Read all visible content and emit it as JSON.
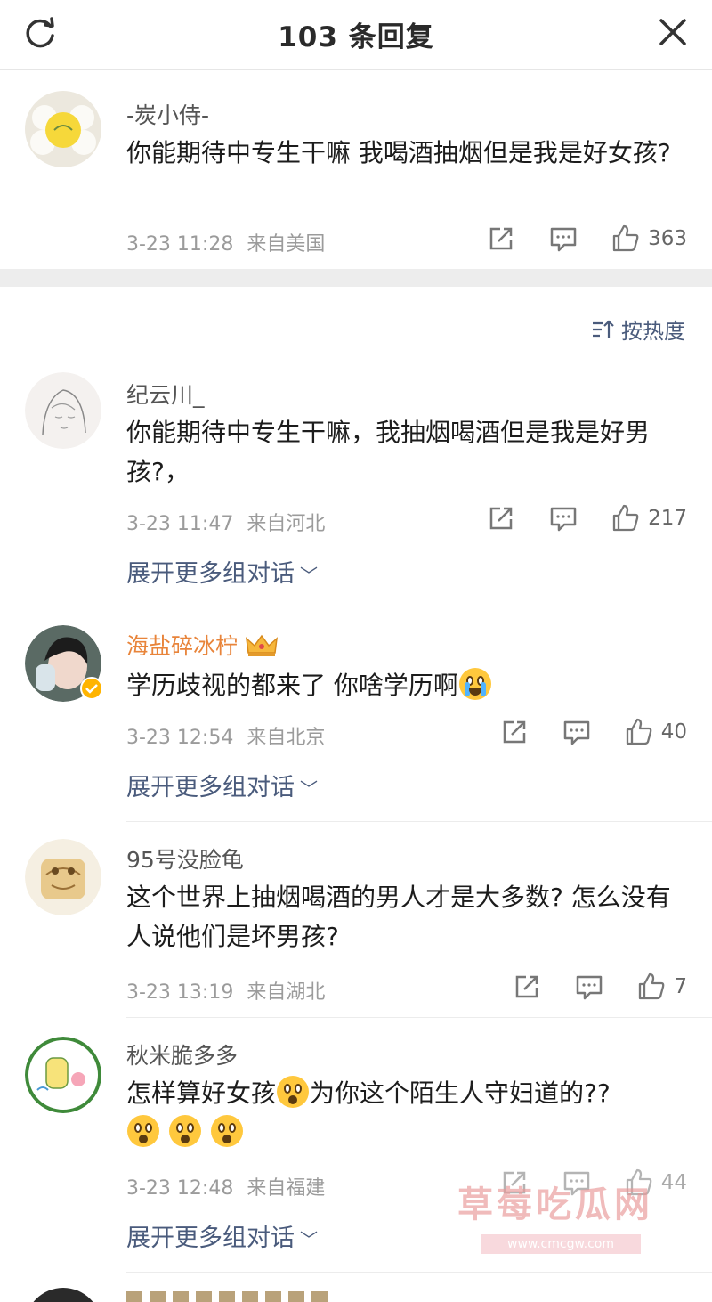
{
  "header": {
    "title": "103 条回复"
  },
  "root_comment": {
    "username": "-炭小侍-",
    "text": "你能期待中专生干嘛 我喝酒抽烟但是我是好女孩?",
    "time": "3-23 11:28",
    "location": "来自美国",
    "likes": "363"
  },
  "sort": {
    "label": "按热度"
  },
  "comments": [
    {
      "username": "纪云川_",
      "text": "你能期待中专生干嘛，我抽烟喝酒但是我是好男孩?，",
      "time": "3-23 11:47",
      "location": "来自河北",
      "likes": "217",
      "expand": "展开更多组对话"
    },
    {
      "username": "海盐碎冰柠",
      "text": "学历歧视的都来了 你啥学历啊",
      "time": "3-23 12:54",
      "location": "来自北京",
      "likes": "40",
      "expand": "展开更多组对话"
    },
    {
      "username": "95号没脸龟",
      "text": "这个世界上抽烟喝酒的男人才是大多数? 怎么没有人说他们是坏男孩?",
      "time": "3-23 13:19",
      "location": "来自湖北",
      "likes": "7"
    },
    {
      "username": "秋米脆多多",
      "text_a": "怎样算好女孩",
      "text_b": "为你这个陌生人守妇道的??",
      "time": "3-23 12:48",
      "location": "来自福建",
      "likes": "44",
      "expand": "展开更多组对话"
    }
  ],
  "watermark": {
    "title": "草莓吃瓜网",
    "url": "www.cmcgw.com"
  },
  "icons": {
    "refresh": "refresh-icon",
    "close": "close-icon",
    "share": "share-icon",
    "comment": "comment-icon",
    "like": "like-icon",
    "sort": "sort-icon",
    "crown": "crown-icon",
    "verified": "verified-badge-icon"
  },
  "colors": {
    "vip_name": "#e8843a",
    "link": "#4a5b7c",
    "meta": "#9b9b9b"
  }
}
